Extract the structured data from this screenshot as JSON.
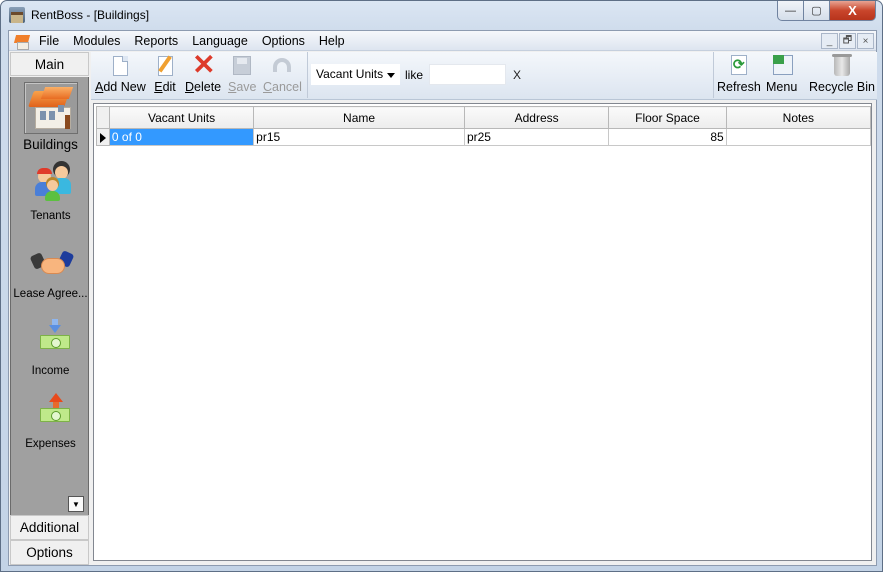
{
  "window": {
    "title": "RentBoss - [Buildings]",
    "controls": {
      "minimize": "—",
      "maximize": "▢",
      "close": "X"
    }
  },
  "menubar": {
    "items": [
      "File",
      "Modules",
      "Reports",
      "Language",
      "Options",
      "Help"
    ],
    "mdi_controls": {
      "minimize": "_",
      "restore": "🗗",
      "close": "×"
    }
  },
  "sidebar": {
    "top_tab": "Main",
    "items": [
      {
        "label": "Buildings",
        "icon": "buildings-icon",
        "active": true
      },
      {
        "label": "Tenants",
        "icon": "tenants-icon",
        "active": false
      },
      {
        "label": "Lease Agree...",
        "icon": "handshake-icon",
        "active": false
      },
      {
        "label": "Income",
        "icon": "income-icon",
        "active": false
      },
      {
        "label": "Expenses",
        "icon": "expenses-icon",
        "active": false
      }
    ],
    "scroll_glyph": "▼",
    "bottom_tabs": [
      "Additional",
      "Options"
    ]
  },
  "toolbar": {
    "add_new": {
      "accel": "A",
      "rest": "dd New"
    },
    "edit": {
      "accel": "E",
      "rest": "dit"
    },
    "delete": {
      "accel": "D",
      "rest": "elete"
    },
    "save": {
      "accel": "S",
      "rest": "ave"
    },
    "cancel": {
      "accel": "C",
      "rest": "ancel"
    },
    "filter": {
      "field_value": "Vacant Units",
      "operator_label": "like",
      "input_value": "",
      "clear_label": "X"
    },
    "refresh": "Refresh",
    "menu": "Menu",
    "recycle_bin": "Recycle Bin"
  },
  "grid": {
    "columns": [
      "Vacant Units",
      "Name",
      "Address",
      "Floor Space",
      "Notes"
    ],
    "rows": [
      {
        "vacant_units": "0 of 0",
        "name": "pr15",
        "address": "pr25",
        "floor_space": "85",
        "notes": ""
      }
    ]
  }
}
